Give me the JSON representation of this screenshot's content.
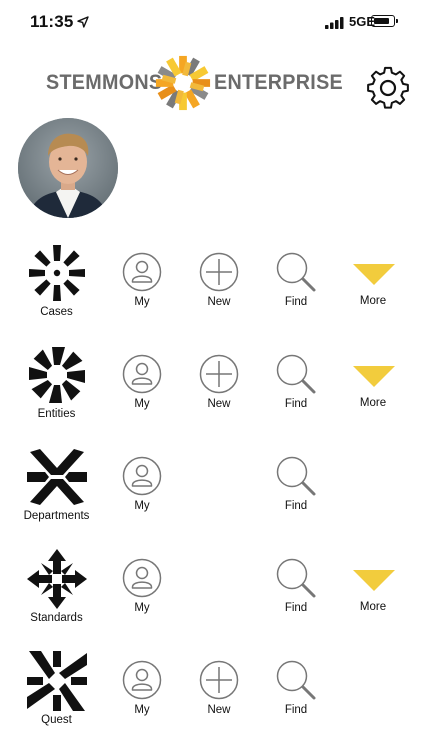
{
  "status_bar": {
    "time": "11:35",
    "network": "5GE"
  },
  "header": {
    "brand_left": "STEMMONS",
    "brand_right": "ENTERPRISE",
    "brand_colors": [
      "#f5a623",
      "#f7c933",
      "#7a7a7a",
      "#e88f1a"
    ]
  },
  "actions": {
    "my": "My",
    "new": "New",
    "find": "Find",
    "more": "More"
  },
  "accent": {
    "more_arrow": "#f2cc3d"
  },
  "modules": [
    {
      "label": "Cases",
      "icon": "cases-icon",
      "actions": [
        "my",
        "new",
        "find",
        "more"
      ]
    },
    {
      "label": "Entities",
      "icon": "entities-icon",
      "actions": [
        "my",
        "new",
        "find",
        "more"
      ]
    },
    {
      "label": "Departments",
      "icon": "departments-icon",
      "actions": [
        "my",
        "find"
      ]
    },
    {
      "label": "Standards",
      "icon": "standards-icon",
      "actions": [
        "my",
        "find",
        "more"
      ]
    },
    {
      "label": "Quest",
      "icon": "quest-icon",
      "actions": [
        "my",
        "new",
        "find"
      ]
    }
  ]
}
